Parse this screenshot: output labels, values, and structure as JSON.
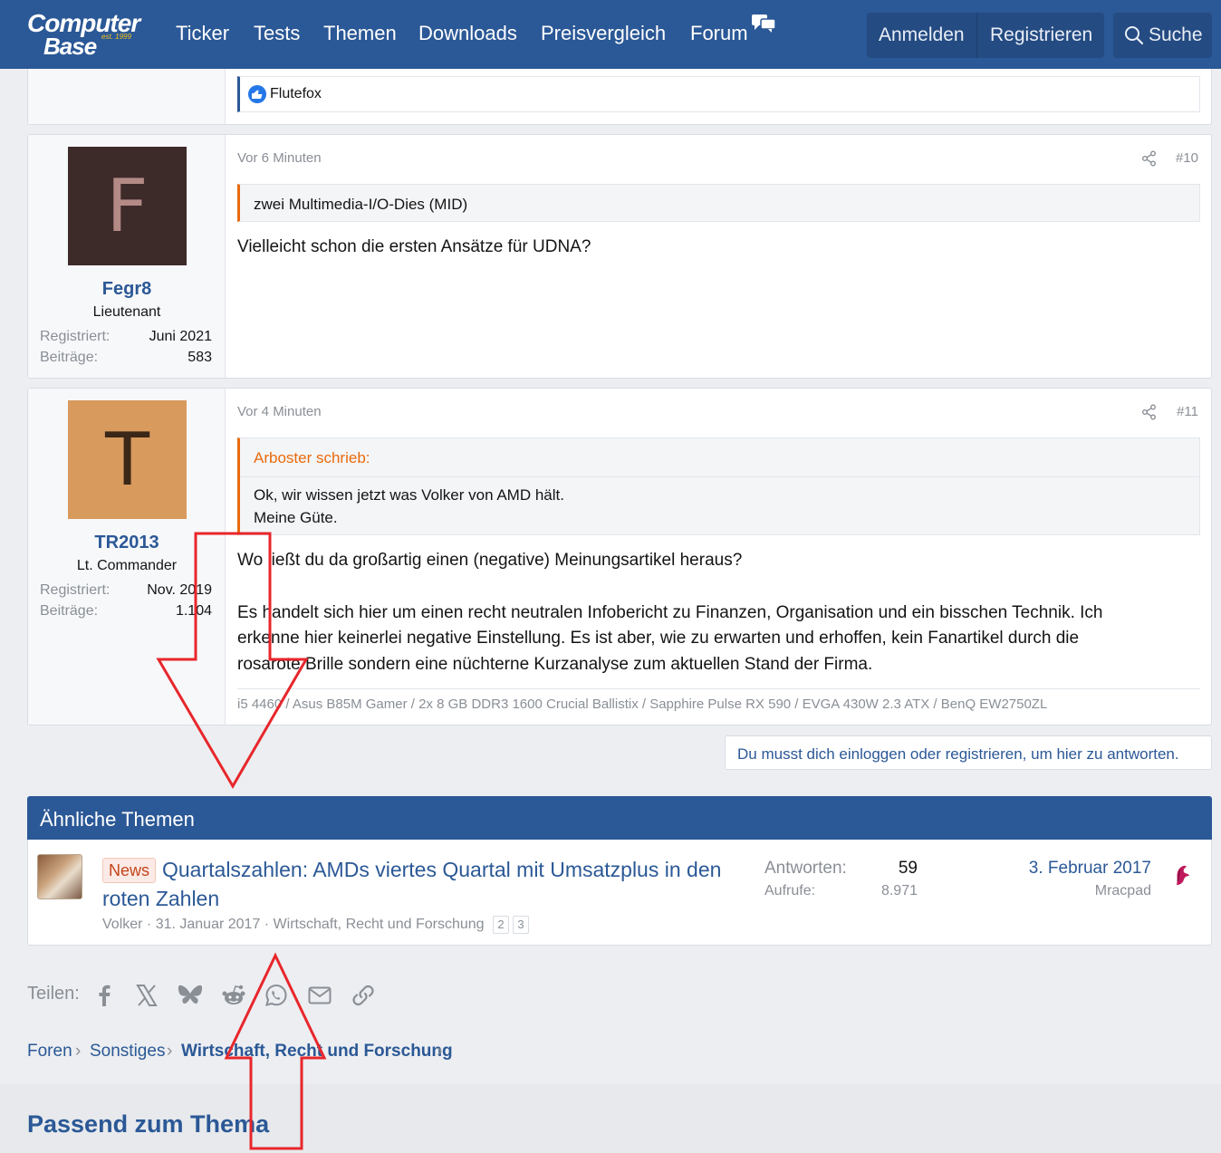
{
  "header": {
    "logo_line1": "Computer",
    "logo_line2": "Base",
    "logo_est": "est. 1999",
    "nav": [
      "Ticker",
      "Tests",
      "Themen",
      "Downloads",
      "Preisvergleich",
      "Forum"
    ],
    "login": "Anmelden",
    "register": "Registrieren",
    "search": "Suche"
  },
  "prev_post": {
    "reaction_user": "Flutefox"
  },
  "posts": [
    {
      "avatar_letter": "F",
      "avatar_bg": "#3d2b2a",
      "avatar_fg": "#b48a86",
      "username": "Fegr8",
      "rank": "Lieutenant",
      "reg_label": "Registriert:",
      "reg_value": "Juni 2021",
      "posts_label": "Beiträge:",
      "posts_value": "583",
      "time": "Vor 6 Minuten",
      "number": "#10",
      "quote_text": "zwei Multimedia-I/O-Dies (MID)",
      "body": "Vielleicht schon die ersten Ansätze für UDNA?"
    },
    {
      "avatar_letter": "T",
      "avatar_bg": "#d89a5d",
      "avatar_fg": "#3a2718",
      "username": "TR2013",
      "rank": "Lt. Commander",
      "reg_label": "Registriert:",
      "reg_value": "Nov. 2019",
      "posts_label": "Beiträge:",
      "posts_value": "1.104",
      "time": "Vor 4 Minuten",
      "number": "#11",
      "quote_author": "Arboster schrieb:",
      "quote_line1": "Ok, wir wissen jetzt was Volker von AMD hält.",
      "quote_line2": "Meine Güte.",
      "body_line1": "Wo ließt du da großartig einen (negative) Meinungsartikel heraus?",
      "body_line2": "Es handelt sich hier um einen recht neutralen Infobericht zu Finanzen, Organisation und ein bisschen Technik. Ich",
      "body_line3": "erkenne hier keinerlei negative Einstellung. Es ist aber, wie zu erwarten und erhoffen, kein Fanartikel durch die",
      "body_line4": "rosarote Brille sondern eine nüchterne Kurzanalyse zum aktuellen Stand der Firma.",
      "signature": "i5 4460 / Asus B85M Gamer / 2x 8 GB DDR3 1600 Crucial Ballistix / Sapphire Pulse RX 590 / EVGA 430W 2.3 ATX / BenQ EW2750ZL"
    }
  ],
  "login_prompt": "Du musst dich einloggen oder registrieren, um hier zu antworten.",
  "similar": {
    "heading": "Ähnliche Themen",
    "badge": "News",
    "title": "Quartalszahlen: AMDs viertes Quartal mit Umsatzplus in den roten Zahlen",
    "meta": "Volker · 31. Januar 2017 · Wirtschaft, Recht und Forschung",
    "pages": [
      "2",
      "3"
    ],
    "replies_label": "Antworten:",
    "replies_value": "59",
    "views_label": "Aufrufe:",
    "views_value": "8.971",
    "last_date": "3. Februar 2017",
    "last_user": "Mracpad"
  },
  "share": {
    "label": "Teilen:",
    "icons": [
      "facebook-icon",
      "x-icon",
      "bluesky-icon",
      "reddit-icon",
      "whatsapp-icon",
      "email-icon",
      "link-icon"
    ]
  },
  "breadcrumbs": [
    "Foren",
    "Sonstiges",
    "Wirtschaft, Recht und Forschung"
  ],
  "related_heading": "Passend zum Thema",
  "colors": {
    "brand": "#2b5896",
    "quote_accent": "#e96a0c",
    "annotation_arrow": "#e8262b"
  }
}
